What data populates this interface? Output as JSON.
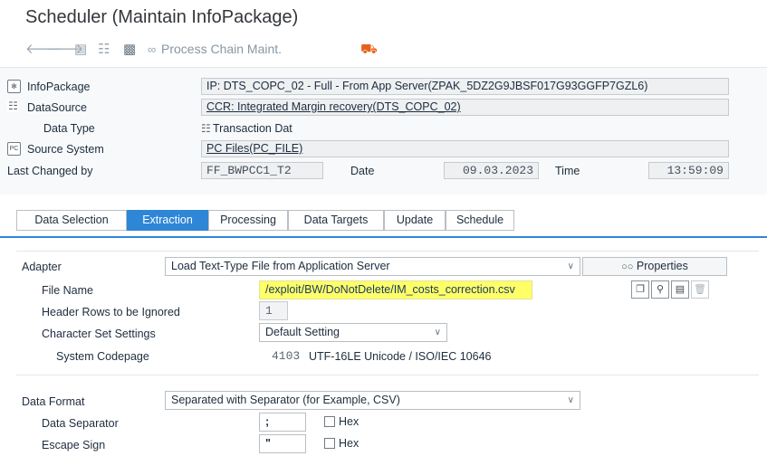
{
  "window": {
    "title": "Scheduler (Maintain InfoPackage)"
  },
  "toolbar": {
    "process_chain_label": "Process Chain Maint."
  },
  "header": {
    "infopackage": {
      "label": "InfoPackage",
      "value": "IP: DTS_COPC_02 - Full - From App Server(ZPAK_5DZ2G9JBSF017G93GGFP7GZL6)"
    },
    "datasource": {
      "label": "DataSource",
      "value": "CCR: Integrated Margin recovery(DTS_COPC_02)"
    },
    "data_type": {
      "label": "Data Type",
      "value": "Transaction Dat"
    },
    "source_system": {
      "label": "Source System",
      "value": "PC Files(PC_FILE)"
    },
    "last_changed": {
      "label": "Last Changed by",
      "user": "FF_BWPCC1_T2",
      "date_label": "Date",
      "date": "09.03.2023",
      "time_label": "Time",
      "time": "13:59:09"
    }
  },
  "tabs": [
    {
      "label": "Data Selection",
      "active": false
    },
    {
      "label": "Extraction",
      "active": true
    },
    {
      "label": "Processing",
      "active": false
    },
    {
      "label": "Data Targets",
      "active": false
    },
    {
      "label": "Update",
      "active": false
    },
    {
      "label": "Schedule",
      "active": false
    }
  ],
  "extraction": {
    "adapter": {
      "label": "Adapter",
      "value": "Load Text-Type File from Application Server",
      "properties_label": "Properties"
    },
    "file_name": {
      "label": "File Name",
      "value": "/exploit/BW/DoNotDelete/IM_costs_correction.csv"
    },
    "header_rows": {
      "label": "Header Rows to be Ignored",
      "value": "1"
    },
    "charset": {
      "label": "Character Set Settings",
      "value": "Default Setting"
    },
    "codepage": {
      "label": "System Codepage",
      "code": "4103",
      "desc": "UTF-16LE Unicode / ISO/IEC 10646"
    },
    "data_format": {
      "label": "Data Format",
      "value": "Separated with Separator (for Example, CSV)"
    },
    "data_separator": {
      "label": "Data Separator",
      "value": ";",
      "hex_label": "Hex"
    },
    "escape_sign": {
      "label": "Escape Sign",
      "value": "\"",
      "hex_label": "Hex"
    }
  },
  "colors": {
    "accent": "#2e86d6",
    "highlight": "#ffff66"
  }
}
